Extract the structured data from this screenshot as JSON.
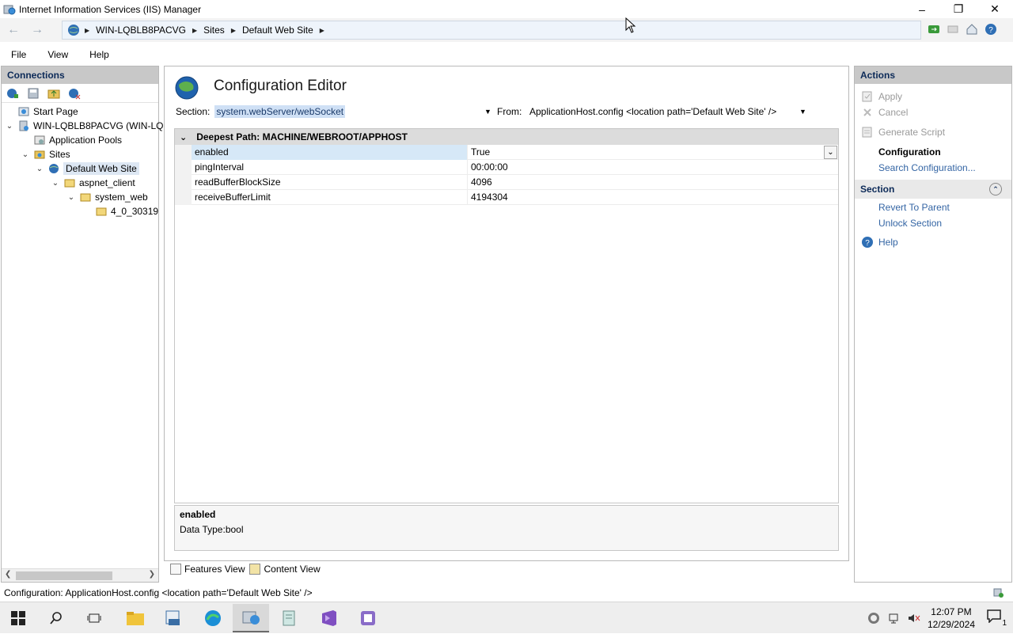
{
  "window": {
    "title": "Internet Information Services (IIS) Manager"
  },
  "address": {
    "crumbs": [
      "WIN-LQBLB8PACVG",
      "Sites",
      "Default Web Site"
    ]
  },
  "menu": [
    "File",
    "View",
    "Help"
  ],
  "connections": {
    "header": "Connections",
    "tree": [
      "Start Page",
      "WIN-LQBLB8PACVG (WIN-LQ",
      "Application Pools",
      "Sites",
      "Default Web Site",
      "aspnet_client",
      "system_web",
      "4_0_30319"
    ]
  },
  "editor": {
    "title": "Configuration Editor",
    "section_label": "Section:",
    "section_value": "system.webServer/webSocket",
    "from_label": "From:",
    "from_value": "ApplicationHost.config <location path='Default Web Site' />",
    "deepest_path": "Deepest Path: MACHINE/WEBROOT/APPHOST",
    "rows": [
      {
        "name": "enabled",
        "value": "True"
      },
      {
        "name": "pingInterval",
        "value": "00:00:00"
      },
      {
        "name": "readBufferBlockSize",
        "value": "4096"
      },
      {
        "name": "receiveBufferLimit",
        "value": "4194304"
      }
    ],
    "info_title": "enabled",
    "info_text": "Data Type:bool"
  },
  "view_tabs": {
    "features": "Features View",
    "content": "Content View"
  },
  "actions": {
    "header": "Actions",
    "apply": "Apply",
    "cancel": "Cancel",
    "generate_script": "Generate Script",
    "configuration": "Configuration",
    "search_configuration": "Search Configuration...",
    "section_header": "Section",
    "revert": "Revert To Parent",
    "unlock": "Unlock Section",
    "help": "Help"
  },
  "status": {
    "text": "Configuration: ApplicationHost.config <location path='Default Web Site' />"
  },
  "taskbar": {
    "time": "12:07 PM",
    "date": "12/29/2024",
    "notif_count": "1"
  }
}
